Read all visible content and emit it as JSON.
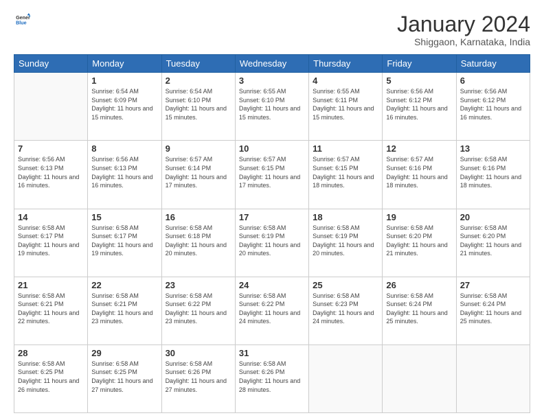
{
  "logo": {
    "line1": "General",
    "line2": "Blue"
  },
  "header": {
    "month": "January 2024",
    "location": "Shiggaon, Karnataka, India"
  },
  "weekdays": [
    "Sunday",
    "Monday",
    "Tuesday",
    "Wednesday",
    "Thursday",
    "Friday",
    "Saturday"
  ],
  "weeks": [
    [
      {
        "day": null
      },
      {
        "day": 1,
        "sunrise": "6:54 AM",
        "sunset": "6:09 PM",
        "daylight": "11 hours and 15 minutes."
      },
      {
        "day": 2,
        "sunrise": "6:54 AM",
        "sunset": "6:10 PM",
        "daylight": "11 hours and 15 minutes."
      },
      {
        "day": 3,
        "sunrise": "6:55 AM",
        "sunset": "6:10 PM",
        "daylight": "11 hours and 15 minutes."
      },
      {
        "day": 4,
        "sunrise": "6:55 AM",
        "sunset": "6:11 PM",
        "daylight": "11 hours and 15 minutes."
      },
      {
        "day": 5,
        "sunrise": "6:56 AM",
        "sunset": "6:12 PM",
        "daylight": "11 hours and 16 minutes."
      },
      {
        "day": 6,
        "sunrise": "6:56 AM",
        "sunset": "6:12 PM",
        "daylight": "11 hours and 16 minutes."
      }
    ],
    [
      {
        "day": 7,
        "sunrise": "6:56 AM",
        "sunset": "6:13 PM",
        "daylight": "11 hours and 16 minutes."
      },
      {
        "day": 8,
        "sunrise": "6:56 AM",
        "sunset": "6:13 PM",
        "daylight": "11 hours and 16 minutes."
      },
      {
        "day": 9,
        "sunrise": "6:57 AM",
        "sunset": "6:14 PM",
        "daylight": "11 hours and 17 minutes."
      },
      {
        "day": 10,
        "sunrise": "6:57 AM",
        "sunset": "6:15 PM",
        "daylight": "11 hours and 17 minutes."
      },
      {
        "day": 11,
        "sunrise": "6:57 AM",
        "sunset": "6:15 PM",
        "daylight": "11 hours and 18 minutes."
      },
      {
        "day": 12,
        "sunrise": "6:57 AM",
        "sunset": "6:16 PM",
        "daylight": "11 hours and 18 minutes."
      },
      {
        "day": 13,
        "sunrise": "6:58 AM",
        "sunset": "6:16 PM",
        "daylight": "11 hours and 18 minutes."
      }
    ],
    [
      {
        "day": 14,
        "sunrise": "6:58 AM",
        "sunset": "6:17 PM",
        "daylight": "11 hours and 19 minutes."
      },
      {
        "day": 15,
        "sunrise": "6:58 AM",
        "sunset": "6:17 PM",
        "daylight": "11 hours and 19 minutes."
      },
      {
        "day": 16,
        "sunrise": "6:58 AM",
        "sunset": "6:18 PM",
        "daylight": "11 hours and 20 minutes."
      },
      {
        "day": 17,
        "sunrise": "6:58 AM",
        "sunset": "6:19 PM",
        "daylight": "11 hours and 20 minutes."
      },
      {
        "day": 18,
        "sunrise": "6:58 AM",
        "sunset": "6:19 PM",
        "daylight": "11 hours and 20 minutes."
      },
      {
        "day": 19,
        "sunrise": "6:58 AM",
        "sunset": "6:20 PM",
        "daylight": "11 hours and 21 minutes."
      },
      {
        "day": 20,
        "sunrise": "6:58 AM",
        "sunset": "6:20 PM",
        "daylight": "11 hours and 21 minutes."
      }
    ],
    [
      {
        "day": 21,
        "sunrise": "6:58 AM",
        "sunset": "6:21 PM",
        "daylight": "11 hours and 22 minutes."
      },
      {
        "day": 22,
        "sunrise": "6:58 AM",
        "sunset": "6:21 PM",
        "daylight": "11 hours and 23 minutes."
      },
      {
        "day": 23,
        "sunrise": "6:58 AM",
        "sunset": "6:22 PM",
        "daylight": "11 hours and 23 minutes."
      },
      {
        "day": 24,
        "sunrise": "6:58 AM",
        "sunset": "6:22 PM",
        "daylight": "11 hours and 24 minutes."
      },
      {
        "day": 25,
        "sunrise": "6:58 AM",
        "sunset": "6:23 PM",
        "daylight": "11 hours and 24 minutes."
      },
      {
        "day": 26,
        "sunrise": "6:58 AM",
        "sunset": "6:24 PM",
        "daylight": "11 hours and 25 minutes."
      },
      {
        "day": 27,
        "sunrise": "6:58 AM",
        "sunset": "6:24 PM",
        "daylight": "11 hours and 25 minutes."
      }
    ],
    [
      {
        "day": 28,
        "sunrise": "6:58 AM",
        "sunset": "6:25 PM",
        "daylight": "11 hours and 26 minutes."
      },
      {
        "day": 29,
        "sunrise": "6:58 AM",
        "sunset": "6:25 PM",
        "daylight": "11 hours and 27 minutes."
      },
      {
        "day": 30,
        "sunrise": "6:58 AM",
        "sunset": "6:26 PM",
        "daylight": "11 hours and 27 minutes."
      },
      {
        "day": 31,
        "sunrise": "6:58 AM",
        "sunset": "6:26 PM",
        "daylight": "11 hours and 28 minutes."
      },
      {
        "day": null
      },
      {
        "day": null
      },
      {
        "day": null
      }
    ]
  ]
}
